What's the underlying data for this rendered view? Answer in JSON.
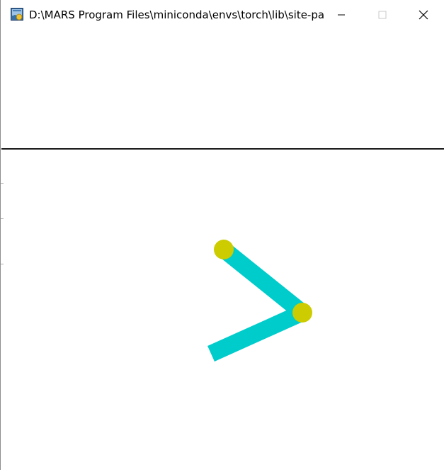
{
  "window": {
    "title": "D:\\MARS Program Files\\miniconda\\envs\\torch\\lib\\site-packa...",
    "controls": {
      "minimize_icon": "minimize-icon",
      "maximize_icon": "maximize-icon",
      "close_icon": "close-icon"
    }
  },
  "scene": {
    "colors": {
      "background": "#ffffff",
      "ground": "#1a1a1a",
      "link": "#00cccc",
      "joint": "#cccc00"
    }
  }
}
